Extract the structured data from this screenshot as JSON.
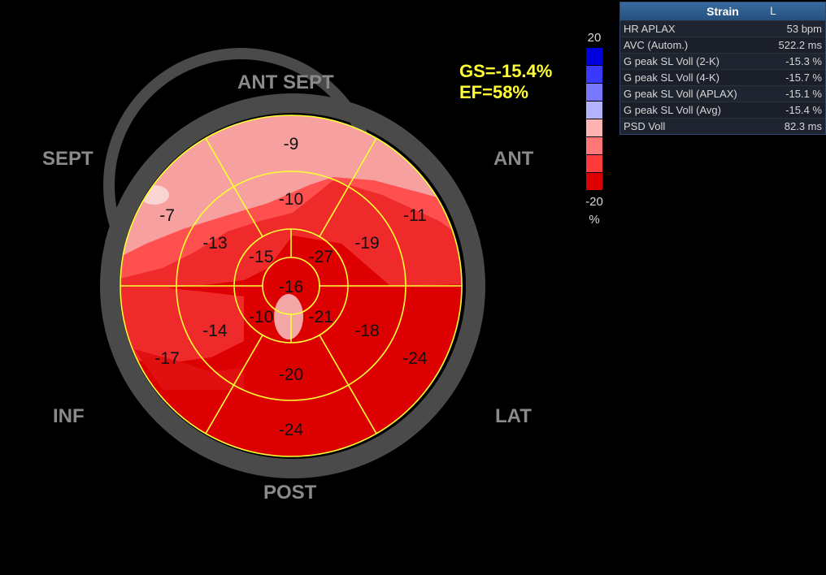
{
  "regions": {
    "ant_sept": "ANT  SEPT",
    "sept": "SEPT",
    "ant": "ANT",
    "inf": "INF",
    "lat": "LAT",
    "post": "POST"
  },
  "global": {
    "gs": "GS=-15.4%",
    "ef": "EF=58%"
  },
  "scale": {
    "max": "20",
    "min": "-20",
    "unit": "%",
    "colors": [
      "#0000dd",
      "#3a3aff",
      "#7777ff",
      "#b3b3ff",
      "#ffb3b3",
      "#ff7777",
      "#ff3a3a",
      "#dd0000"
    ]
  },
  "segments": {
    "basal": [
      "-9",
      "-11",
      "-24",
      "-24",
      "-17",
      "-7"
    ],
    "mid": [
      "-10",
      "-19",
      "-18",
      "-20",
      "-14",
      "-13"
    ],
    "apical": [
      "-27",
      "-21",
      "-10",
      "-15"
    ],
    "apex": "-16"
  },
  "strain_panel": {
    "title": "Strain",
    "mark": "L",
    "rows": [
      {
        "label": "HR APLAX",
        "value": "53 bpm"
      },
      {
        "label": "AVC (Autom.)",
        "value": "522.2 ms"
      },
      {
        "label": "G peak SL Voll (2-K)",
        "value": "-15.3 %"
      },
      {
        "label": "G peak SL Voll (4-K)",
        "value": "-15.7 %"
      },
      {
        "label": "G peak SL Voll (APLAX)",
        "value": "-15.1 %"
      },
      {
        "label": "G peak SL Voll (Avg)",
        "value": "-15.4 %"
      },
      {
        "label": "PSD Voll",
        "value": "82.3 ms"
      }
    ]
  },
  "colors": {
    "grid": "#ffff33",
    "ring": "#4a4a4a",
    "light_pink": "#f5a7a7",
    "mid_red": "#ff4d4d",
    "red": "#ee2222",
    "deep_red": "#dd0000"
  }
}
